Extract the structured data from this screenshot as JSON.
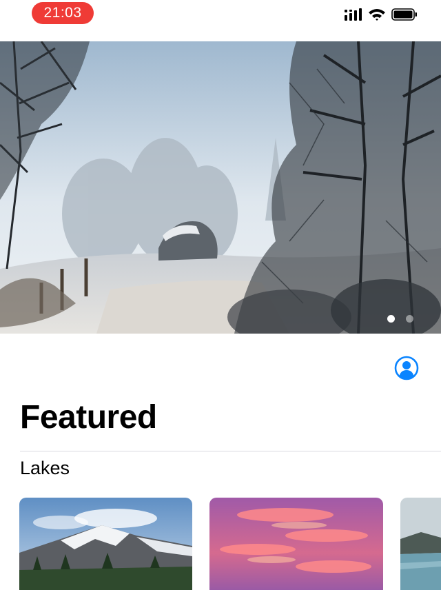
{
  "status_bar": {
    "time": "21:03",
    "signal_icon": "cellular-signal-icon",
    "wifi_icon": "wifi-icon",
    "battery_icon": "battery-icon"
  },
  "hero": {
    "image": "snowy-forest-path",
    "page_count": 2,
    "active_page": 1
  },
  "header": {
    "profile_icon": "person-circle-icon",
    "title": "Featured"
  },
  "section": {
    "title": "Lakes"
  },
  "cards": [
    {
      "image": "snowy-mountain"
    },
    {
      "image": "pink-sunset-sky"
    },
    {
      "image": "lake-shore"
    }
  ],
  "colors": {
    "accent": "#0a84ff",
    "time_pill": "#ef3b36"
  }
}
